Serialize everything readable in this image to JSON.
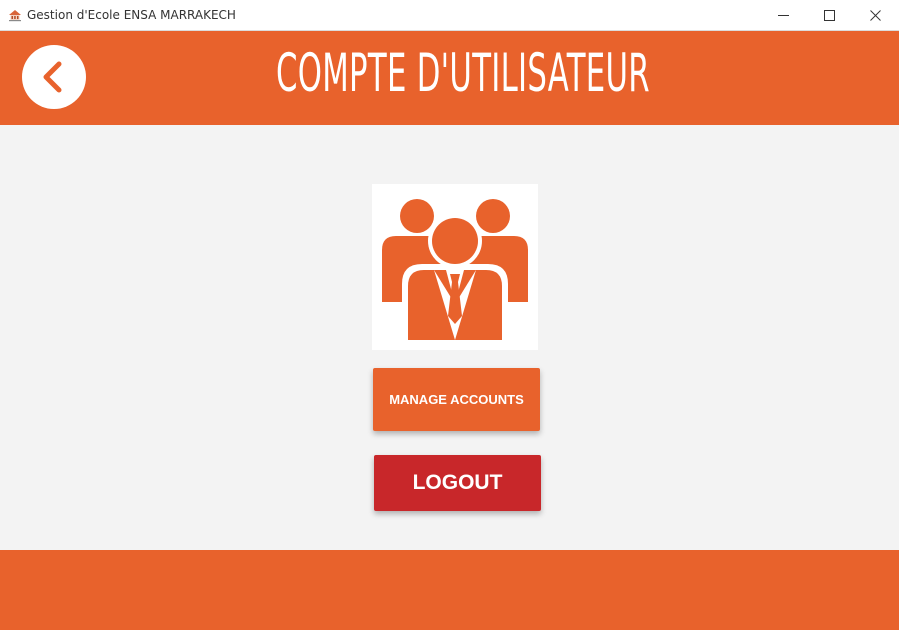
{
  "window": {
    "title": "Gestion d'Ecole ENSA MARRAKECH",
    "minimize_icon": "minimize-icon",
    "maximize_icon": "maximize-icon",
    "close_icon": "close-icon"
  },
  "header": {
    "title": "COMPTE D'UTILISATEUR",
    "back_icon": "chevron-left-icon"
  },
  "main": {
    "image_icon": "users-group-icon",
    "manage_label": "MANAGE ACCOUNTS",
    "logout_label": "LOGOUT"
  },
  "colors": {
    "accent": "#e8622c",
    "logout": "#c8272a",
    "background": "#f3f3f3"
  }
}
